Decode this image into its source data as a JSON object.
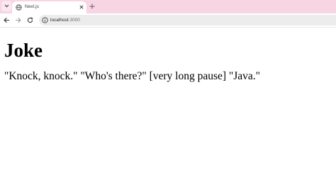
{
  "browser": {
    "tab": {
      "title": "Next.js",
      "icon": "globe-icon"
    },
    "new_tab_symbol": "+",
    "address": {
      "host": "localhost",
      "port": ":3000"
    },
    "colors": {
      "tabstrip": "#f7d5e3",
      "omnibox": "#ececec"
    }
  },
  "page": {
    "heading": "Joke",
    "joke_text": "\"Knock, knock.\" \"Who's there?\" [very long pause] \"Java.\""
  }
}
